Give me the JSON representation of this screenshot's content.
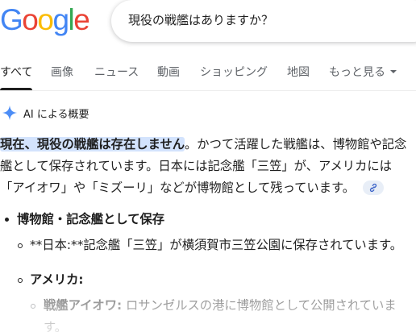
{
  "logo": {
    "letters": [
      "G",
      "o",
      "o",
      "g",
      "l",
      "e"
    ],
    "colors": [
      "#4285F4",
      "#EA4335",
      "#FBBC05",
      "#4285F4",
      "#34A853",
      "#EA4335"
    ]
  },
  "search": {
    "query": "現役の戦艦はありますか？"
  },
  "tabs": {
    "all": "すべて",
    "images": "画像",
    "news": "ニュース",
    "videos": "動画",
    "shopping": "ショッピング",
    "maps": "地図",
    "more": "もっと見る"
  },
  "ai_overview": {
    "icon": "sparkle-icon",
    "title": "AI による概要",
    "highlight": "現在、現役の戦艦は存在しません",
    "answer_rest": "。かつて活躍した戦艦は、博物館や記念艦として保存されています。日本には記念艦「三笠」が、アメリカには「アイオワ」や「ミズーリ」などが博物館として残っています。",
    "link_icon": "link-icon"
  },
  "bullets": {
    "item1_title": "博物館・記念艦として保存",
    "item1_sub1": "**日本:**記念艦「三笠」が横須賀市三笠公園に保存されています。",
    "item1_sub2_label": "アメリカ:",
    "item1_sub2_sub1_label": "戦艦アイオワ:",
    "item1_sub2_sub1_text": " ロサンゼルスの港に博物館として公開されています。"
  },
  "colors": {
    "highlight_bg": "#d3e3fd",
    "sparkle": "#4c8df6",
    "text": "#1f1f1f",
    "muted": "#5f6368"
  }
}
